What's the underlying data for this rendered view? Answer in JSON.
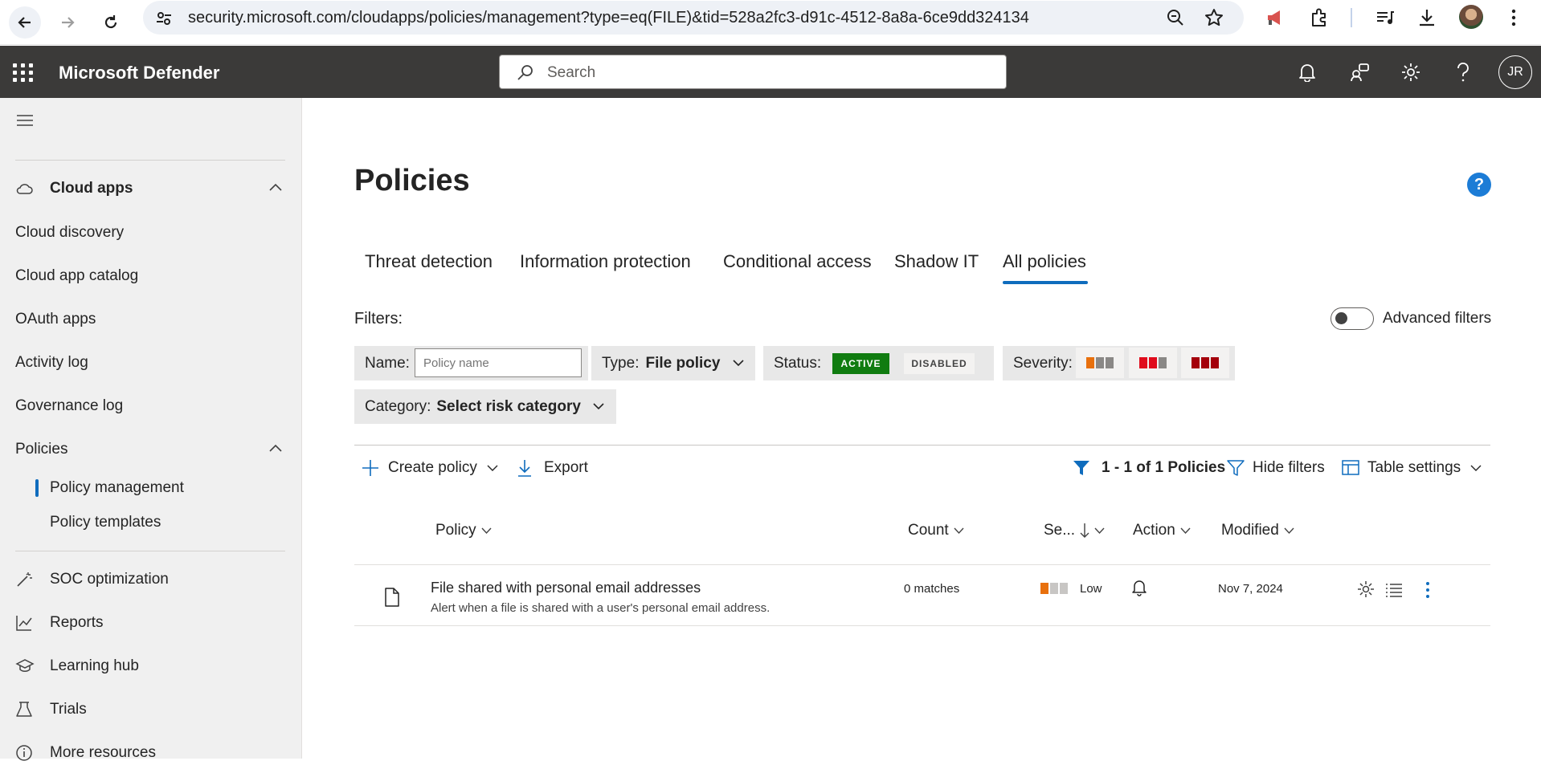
{
  "browser": {
    "url": "security.microsoft.com/cloudapps/policies/management?type=eq(FILE)&tid=528a2fc3-d91c-4512-8a8a-6ce9dd324134"
  },
  "header": {
    "app_title": "Microsoft Defender",
    "search_placeholder": "Search",
    "user_initials": "JR"
  },
  "sidebar": {
    "section_cloud_apps": "Cloud apps",
    "items": [
      {
        "label": "Cloud discovery"
      },
      {
        "label": "Cloud app catalog"
      },
      {
        "label": "OAuth apps"
      },
      {
        "label": "Activity log"
      },
      {
        "label": "Governance log"
      },
      {
        "label": "Policies"
      },
      {
        "label": "Policy management"
      },
      {
        "label": "Policy templates"
      },
      {
        "label": "SOC optimization"
      },
      {
        "label": "Reports"
      },
      {
        "label": "Learning hub"
      },
      {
        "label": "Trials"
      },
      {
        "label": "More resources"
      }
    ]
  },
  "page": {
    "title": "Policies",
    "help_glyph": "?",
    "tabs": [
      {
        "label": "Threat detection"
      },
      {
        "label": "Information protection"
      },
      {
        "label": "Conditional access"
      },
      {
        "label": "Shadow IT"
      },
      {
        "label": "All policies"
      }
    ],
    "active_tab": "All policies"
  },
  "filters": {
    "label": "Filters:",
    "advanced_label": "Advanced filters",
    "advanced_on": false,
    "name_label": "Name:",
    "name_placeholder": "Policy name",
    "type_label": "Type:",
    "type_value": "File policy",
    "status_label": "Status:",
    "status_active": "ACTIVE",
    "status_disabled": "DISABLED",
    "severity_label": "Severity:",
    "category_label": "Category:",
    "category_value": "Select risk category"
  },
  "commands": {
    "create": "Create policy",
    "export": "Export",
    "count_text": "1 - 1 of 1 Policies",
    "hide_filters": "Hide filters",
    "table_settings": "Table settings"
  },
  "table": {
    "columns": [
      "Policy",
      "Count",
      "Se...",
      "Action",
      "Modified"
    ],
    "rows": [
      {
        "name": "File shared with personal email addresses",
        "description": "Alert when a file is shared with a user's personal email address.",
        "count": "0 matches",
        "severity": "Low",
        "modified": "Nov 7, 2024"
      }
    ]
  },
  "colors": {
    "header_bg": "#3b3a39",
    "accent": "#0f6cbd",
    "active_green": "#107c10",
    "sev_low": "#e8700d",
    "sev_medium": "#e00b1c",
    "sev_high": "#a4000b"
  }
}
